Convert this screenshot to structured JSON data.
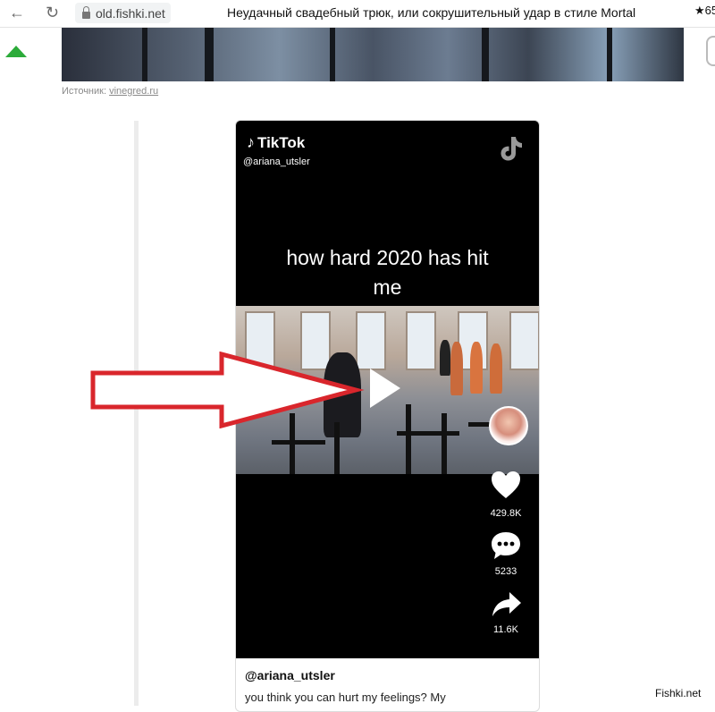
{
  "browser": {
    "url": "old.fishki.net",
    "page_title": "Неудачный свадебный трюк, или сокрушительный удар в стиле Mortal",
    "rating": "★65"
  },
  "article": {
    "source_label": "Источник:",
    "source_link": "vinegred.ru"
  },
  "tiktok": {
    "logo": "TikTok",
    "handle_top": "@ariana_utsler",
    "video_caption_line1": "how hard 2020 has hit",
    "video_caption_line2": "me",
    "likes": "429.8K",
    "comments": "5233",
    "shares": "11.6K",
    "username": "@ariana_utsler",
    "description": "you think you can hurt my feelings? My"
  },
  "watermark": "Fishki.net",
  "colors": {
    "up_arrow": "#2cab3a",
    "annotation_arrow": "#d9262c",
    "tiktok_bg": "#000000"
  },
  "icons": [
    "back-arrow-icon",
    "reload-icon",
    "lock-icon",
    "up-vote-icon",
    "tiktok-logo-icon",
    "play-icon",
    "heart-icon",
    "comment-icon",
    "share-icon"
  ]
}
